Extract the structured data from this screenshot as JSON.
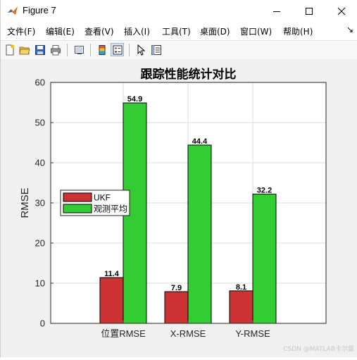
{
  "window": {
    "title": "Figure 7",
    "min_glyph": "—",
    "max_glyph": "☐",
    "close_glyph": "✕"
  },
  "menu": {
    "items": [
      "文件(F)",
      "编辑(E)",
      "查看(V)",
      "插入(I)",
      "工具(T)",
      "桌面(D)",
      "窗口(W)",
      "帮助(H)"
    ],
    "more": "↘"
  },
  "toolbar": {
    "icons": [
      "new-figure-icon",
      "open-file-icon",
      "save-icon",
      "print-icon",
      "link-plot-icon",
      "colorbar-icon",
      "legend-icon",
      "pointer-icon",
      "property-inspector-icon"
    ]
  },
  "colors": {
    "ukf": "#cc3333",
    "obs": "#33cc33",
    "grid": "#dcdcdc"
  },
  "chart_data": {
    "type": "bar",
    "title": "跟踪性能统计对比",
    "xlabel": "",
    "ylabel": "RMSE",
    "categories": [
      "位置RMSE",
      "X-RMSE",
      "Y-RMSE"
    ],
    "ylim": [
      0,
      60
    ],
    "yticks": [
      "0",
      "10",
      "20",
      "30",
      "40",
      "50",
      "60"
    ],
    "grid": true,
    "legend_position": "west",
    "series": [
      {
        "name": "UKF",
        "values": [
          11.4,
          7.9,
          8.1
        ],
        "labels": [
          "11.4",
          "7.9",
          "8.1"
        ]
      },
      {
        "name": "观测平均",
        "values": [
          54.9,
          44.4,
          32.2
        ],
        "labels": [
          "54.9",
          "44.4",
          "32.2"
        ]
      }
    ]
  },
  "watermark": "CSDN @MATLAB卡尔曼"
}
